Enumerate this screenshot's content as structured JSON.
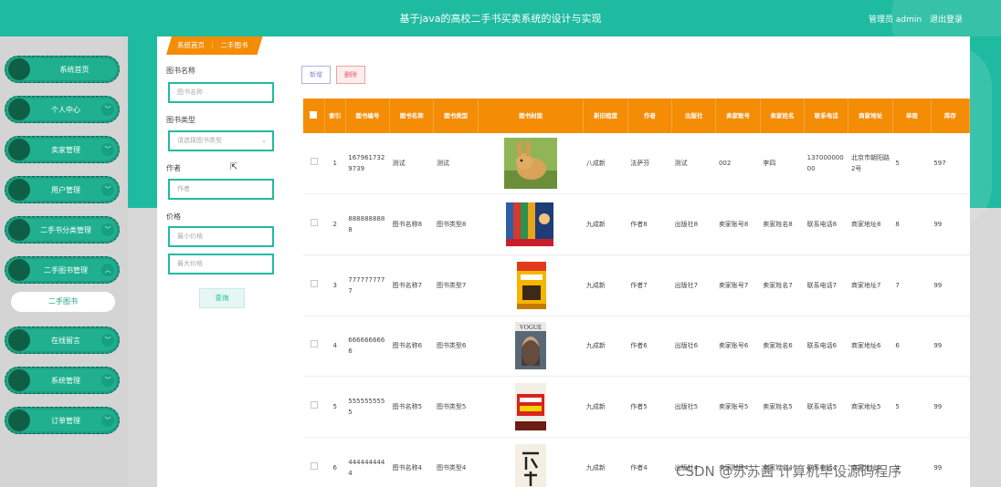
{
  "header": {
    "title": "基于java的高校二手书买卖系统的设计与实现",
    "user_label": "管理员 admin",
    "logout_label": "退出登录"
  },
  "sidebar": {
    "items": [
      {
        "label": "系统首页",
        "has_arrow": false
      },
      {
        "label": "个人中心",
        "has_arrow": true
      },
      {
        "label": "卖家管理",
        "has_arrow": true
      },
      {
        "label": "用户管理",
        "has_arrow": true
      },
      {
        "label": "二手书分类管理",
        "has_arrow": true
      },
      {
        "label": "二手图书管理",
        "has_arrow": true,
        "expanded": true
      },
      {
        "label": "在线留言",
        "has_arrow": true
      },
      {
        "label": "系统管理",
        "has_arrow": true
      },
      {
        "label": "订单管理",
        "has_arrow": true
      }
    ],
    "active_sub": "二手图书"
  },
  "breadcrumb": {
    "home": "系统首页",
    "sep": "⋮",
    "current": "二手图书"
  },
  "filters": {
    "name_label": "图书名称",
    "name_placeholder": "图书名称",
    "type_label": "图书类型",
    "type_placeholder": "请选择图书类型",
    "author_label": "作者",
    "author_placeholder": "作者",
    "price_label": "价格",
    "min_price_placeholder": "最小价格",
    "max_price_placeholder": "最大价格",
    "search_label": "查询"
  },
  "actions": {
    "add_label": "新增",
    "delete_label": "删除"
  },
  "table": {
    "headers": [
      "索引",
      "图书编号",
      "图书名称",
      "图书类型",
      "图书封面",
      "新旧程度",
      "作者",
      "出版社",
      "卖家账号",
      "卖家姓名",
      "联系电话",
      "商家地址",
      "单限",
      "库存"
    ],
    "rows": [
      {
        "index": "1",
        "code": "1679617329739",
        "name": "测试",
        "type": "测试",
        "cover": "rabbit",
        "condition": "八成新",
        "author": "法萨芬",
        "publisher": "测试",
        "seller_acc": "002",
        "seller_name": "李四",
        "phone": "13700000000",
        "address": "北京市朝阳路2号",
        "limit": "5",
        "stock": "597"
      },
      {
        "index": "2",
        "code": "8888888888",
        "name": "图书名称8",
        "type": "图书类型8",
        "cover": "conan",
        "condition": "九成新",
        "author": "作者8",
        "publisher": "出版社8",
        "seller_acc": "卖家账号8",
        "seller_name": "卖家姓名8",
        "phone": "联系电话8",
        "address": "商家地址8",
        "limit": "8",
        "stock": "99"
      },
      {
        "index": "3",
        "code": "7777777777",
        "name": "图书名称7",
        "type": "图书类型7",
        "cover": "yellow-book",
        "condition": "九成新",
        "author": "作者7",
        "publisher": "出版社7",
        "seller_acc": "卖家账号7",
        "seller_name": "卖家姓名7",
        "phone": "联系电话7",
        "address": "商家地址7",
        "limit": "7",
        "stock": "99"
      },
      {
        "index": "4",
        "code": "6666666666",
        "name": "图书名称6",
        "type": "图书类型6",
        "cover": "vogue",
        "condition": "九成新",
        "author": "作者6",
        "publisher": "出版社6",
        "seller_acc": "卖家账号6",
        "seller_name": "卖家姓名6",
        "phone": "联系电话6",
        "address": "商家地址6",
        "limit": "6",
        "stock": "99"
      },
      {
        "index": "5",
        "code": "5555555555",
        "name": "图书名称5",
        "type": "图书类型5",
        "cover": "red-book",
        "condition": "九成新",
        "author": "作者5",
        "publisher": "出版社5",
        "seller_acc": "卖家账号5",
        "seller_name": "卖家姓名5",
        "phone": "联系电话5",
        "address": "商家地址5",
        "limit": "5",
        "stock": "99"
      },
      {
        "index": "6",
        "code": "4444444444",
        "name": "图书名称4",
        "type": "图书类型4",
        "cover": "calligraphy",
        "condition": "九成新",
        "author": "作者4",
        "publisher": "出版社4",
        "seller_acc": "卖家账号4",
        "seller_name": "卖家姓名4",
        "phone": "联系电话4",
        "address": "商家地址4",
        "limit": "4",
        "stock": "99"
      }
    ]
  },
  "watermark": "CSDN @苏苏酱    计算机毕设源码程序",
  "colors": {
    "primary": "#1fbba0",
    "header_orange": "#f48c06",
    "nav_dark": "#0f5f47"
  }
}
